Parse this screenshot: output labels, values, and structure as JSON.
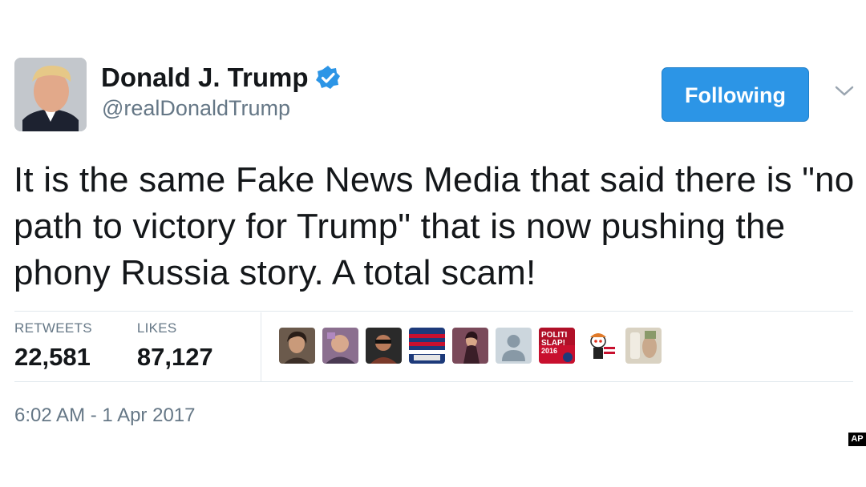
{
  "user": {
    "display_name": "Donald J. Trump",
    "handle": "@realDonaldTrump",
    "verified": true
  },
  "follow_button": {
    "label": "Following"
  },
  "tweet": {
    "text": "It is the same Fake News Media that said there is \"no path to victory for Trump\" that is now pushing the phony Russia story. A total scam!",
    "timestamp": "6:02 AM - 1 Apr 2017"
  },
  "stats": {
    "retweets_label": "RETWEETS",
    "retweets_value": "22,581",
    "likes_label": "LIKES",
    "likes_value": "87,127"
  },
  "likers": [
    {
      "icon": "user-avatar"
    },
    {
      "icon": "user-avatar"
    },
    {
      "icon": "user-avatar"
    },
    {
      "icon": "user-avatar"
    },
    {
      "icon": "user-avatar"
    },
    {
      "icon": "default-egg-avatar"
    },
    {
      "icon": "politislap-avatar",
      "text": "POLITI SLAP! 2016"
    },
    {
      "icon": "cartoon-avatar"
    },
    {
      "icon": "user-avatar"
    }
  ],
  "watermark": {
    "text": "AP"
  },
  "colors": {
    "accent": "#2c95e6",
    "secondary_text": "#657786",
    "primary_text": "#14171a"
  }
}
